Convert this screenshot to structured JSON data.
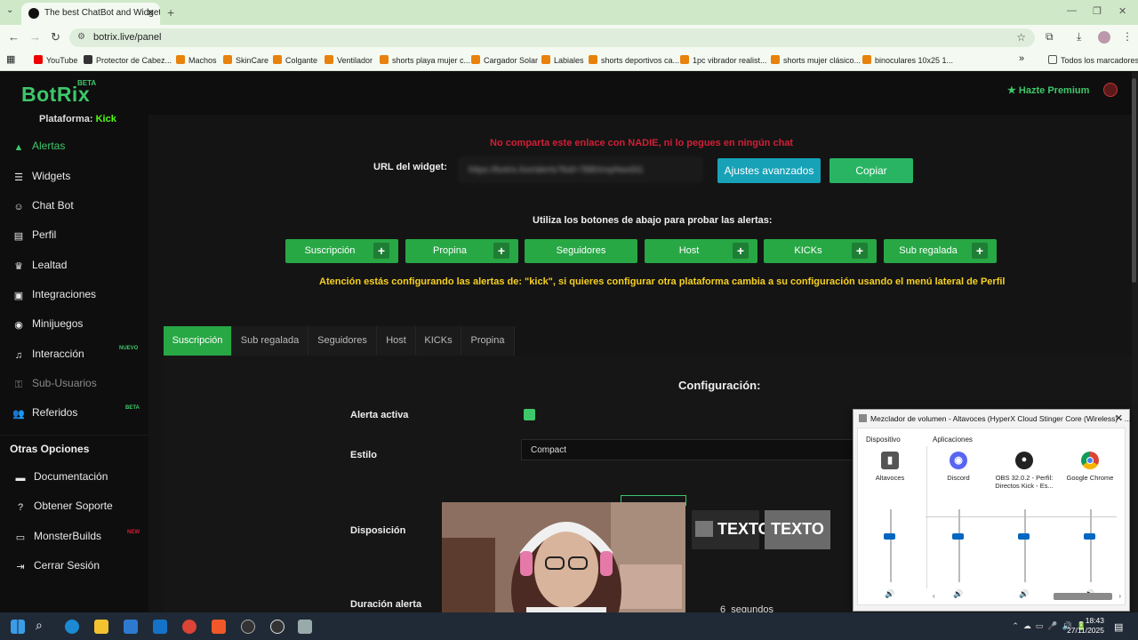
{
  "browser": {
    "tab_title": "The best ChatBot and Widgets",
    "url": "botrix.live/panel",
    "bookmarks": [
      "YouTube",
      "Protector de Cabez...",
      "Machos",
      "SkinCare",
      "Colgante",
      "Ventilador",
      "shorts playa mujer c...",
      "Cargador Solar",
      "Labiales",
      "shorts deportivos ca...",
      "1pc vibrador realist...",
      "shorts mujer clásico...",
      "binoculares 10x25 1..."
    ],
    "all_bookmarks": "Todos los marcadores"
  },
  "sidebar": {
    "logo": "BotRix",
    "beta": "BETA",
    "platform_label": "Plataforma:",
    "platform_value": "Kick",
    "items": [
      {
        "label": "Alertas",
        "icon": "warning-icon",
        "active": true
      },
      {
        "label": "Widgets",
        "icon": "list-icon"
      },
      {
        "label": "Chat Bot",
        "icon": "robot-icon"
      },
      {
        "label": "Perfil",
        "icon": "id-card-icon"
      },
      {
        "label": "Lealtad",
        "icon": "trophy-icon"
      },
      {
        "label": "Integraciones",
        "icon": "puzzle-icon"
      },
      {
        "label": "Minijuegos",
        "icon": "gamepad-icon"
      },
      {
        "label": "Interacción",
        "icon": "music-icon",
        "tag": "NUEVO"
      },
      {
        "label": "Sub-Usuarios",
        "icon": "lock-icon",
        "dim": true
      },
      {
        "label": "Referidos",
        "icon": "users-icon",
        "tag": "BETA"
      }
    ],
    "other_title": "Otras Opciones",
    "other_items": [
      {
        "label": "Documentación",
        "icon": "book-icon"
      },
      {
        "label": "Obtener Soporte",
        "icon": "help-icon"
      },
      {
        "label": "MonsterBuilds",
        "icon": "laptop-icon",
        "tag": "NEW"
      },
      {
        "label": "Cerrar Sesión",
        "icon": "logout-icon"
      }
    ]
  },
  "header": {
    "premium": "Hazte Premium"
  },
  "widget": {
    "warning": "No comparta este enlace con NADIE, ni lo pegues en ningún chat",
    "url_label": "URL del widget:",
    "url_value": "https://botrix.live/alerts?bid=7BBXmpNws5G",
    "advanced_btn": "Ajustes avanzados",
    "copy_btn": "Copiar",
    "test_prompt": "Utiliza los botones de abajo para probar las alertas:",
    "test_buttons": [
      "Suscripción",
      "Propina",
      "Seguidores",
      "Host",
      "KICKs",
      "Sub regalada"
    ],
    "attention": "Atención estás configurando las alertas de: \"kick\", si quieres configurar otra plataforma cambia a su configuración usando el menú lateral de Perfil"
  },
  "config_tabs": [
    "Suscripción",
    "Sub regalada",
    "Seguidores",
    "Host",
    "KICKs",
    "Propina"
  ],
  "config": {
    "title": "Configuración:",
    "active_label": "Alerta activa",
    "style_label": "Estilo",
    "style_value": "Compact",
    "layout_label": "Disposición",
    "layout_thumb_text": "TEXTO",
    "duration_label": "Duración alerta",
    "duration_value": "6",
    "duration_unit": "segundos"
  },
  "mixer": {
    "title": "Mezclador de volumen - Altavoces (HyperX Cloud Stinger Core (Wireless) - ...",
    "device_head": "Dispositivo",
    "apps_head": "Aplicaciones",
    "channels": [
      {
        "name": "Altavoces",
        "icon": "speaker-icon",
        "level": 0.62
      },
      {
        "name": "Discord",
        "icon": "discord-icon",
        "level": 0.62
      },
      {
        "name": "OBS 32.0.2 - Perfil: Directos Kick - Es...",
        "icon": "obs-icon",
        "level": 0.62
      },
      {
        "name": "Google Chrome",
        "icon": "chrome-icon",
        "level": 0.62
      }
    ]
  },
  "taskbar": {
    "time": "18:43",
    "date": "27/11/2025"
  },
  "colors": {
    "accent": "#3ec76a",
    "button_green": "#28a745",
    "info": "#17a2b8",
    "danger": "#d11f36",
    "warn_yellow": "#f5d020"
  }
}
